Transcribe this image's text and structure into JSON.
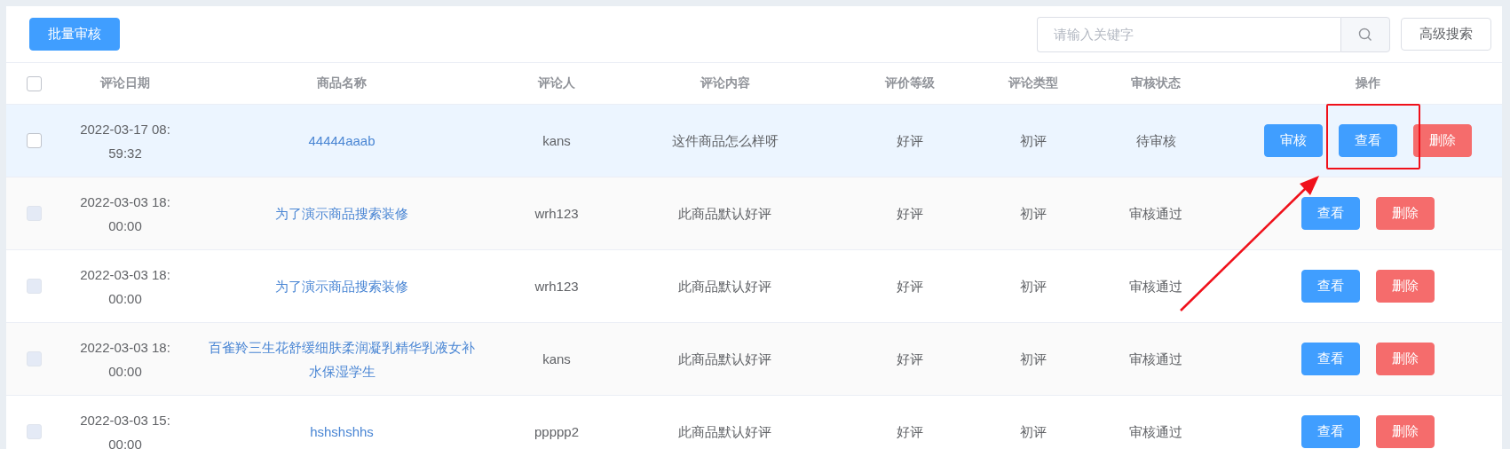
{
  "toolbar": {
    "batch_button": "批量审核",
    "search": {
      "placeholder": "请输入关键字"
    },
    "advanced_button": "高级搜索"
  },
  "table": {
    "columns": [
      "评论日期",
      "商品名称",
      "评论人",
      "评论内容",
      "评价等级",
      "评论类型",
      "审核状态",
      "操作"
    ],
    "header_checkbox": {
      "checked": false
    },
    "rows": [
      {
        "checkbox": {
          "checked": false,
          "disabled": false
        },
        "highlighted": true,
        "date": "2022-03-17 08:59:32",
        "product": "44444aaab",
        "reviewer": "kans",
        "content": "这件商品怎么样呀",
        "grade": "好评",
        "type": "初评",
        "status": "待审核",
        "actions": [
          {
            "kind": "primary",
            "label": "审核"
          },
          {
            "kind": "primary",
            "label": "查看"
          },
          {
            "kind": "danger",
            "label": "删除"
          }
        ]
      },
      {
        "checkbox": {
          "checked": false,
          "disabled": true
        },
        "highlighted": false,
        "date": "2022-03-03 18:00:00",
        "product": "为了演示商品搜索装修",
        "reviewer": "wrh123",
        "content": "此商品默认好评",
        "grade": "好评",
        "type": "初评",
        "status": "审核通过",
        "actions": [
          {
            "kind": "primary",
            "label": "查看"
          },
          {
            "kind": "danger",
            "label": "删除"
          }
        ]
      },
      {
        "checkbox": {
          "checked": false,
          "disabled": true
        },
        "highlighted": false,
        "date": "2022-03-03 18:00:00",
        "product": "为了演示商品搜索装修",
        "reviewer": "wrh123",
        "content": "此商品默认好评",
        "grade": "好评",
        "type": "初评",
        "status": "审核通过",
        "actions": [
          {
            "kind": "primary",
            "label": "查看"
          },
          {
            "kind": "danger",
            "label": "删除"
          }
        ]
      },
      {
        "checkbox": {
          "checked": false,
          "disabled": true
        },
        "highlighted": false,
        "date": "2022-03-03 18:00:00",
        "product": "百雀羚三生花舒缓细肤柔润凝乳精华乳液女补水保湿学生",
        "reviewer": "kans",
        "content": "此商品默认好评",
        "grade": "好评",
        "type": "初评",
        "status": "审核通过",
        "actions": [
          {
            "kind": "primary",
            "label": "查看"
          },
          {
            "kind": "danger",
            "label": "删除"
          }
        ]
      },
      {
        "checkbox": {
          "checked": false,
          "disabled": true
        },
        "highlighted": false,
        "date": "2022-03-03 15:00:00",
        "product": "hshshshhs",
        "reviewer": "ppppp2",
        "content": "此商品默认好评",
        "grade": "好评",
        "type": "初评",
        "status": "审核通过",
        "actions": [
          {
            "kind": "primary",
            "label": "查看"
          },
          {
            "kind": "danger",
            "label": "删除"
          }
        ]
      }
    ]
  },
  "annotation": {
    "kind": "highlight-arrow"
  }
}
